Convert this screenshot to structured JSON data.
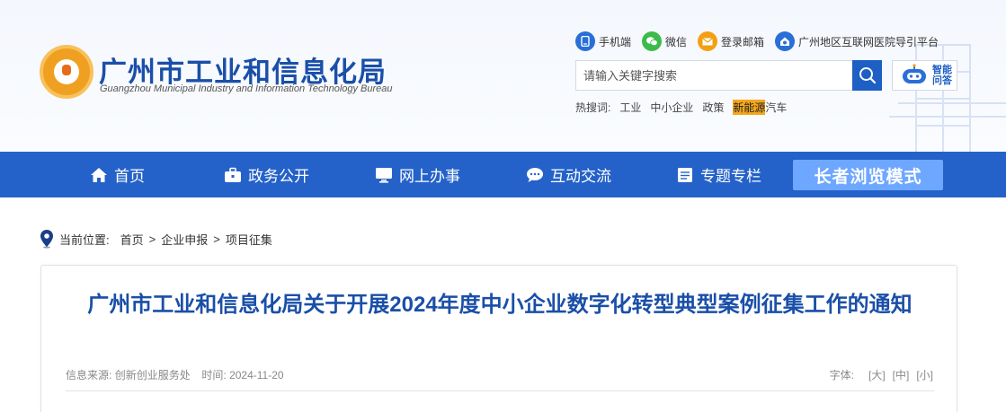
{
  "site": {
    "name_cn": "广州市工业和信息化局",
    "name_en": "Guangzhou Municipal Industry and Information Technology Bureau"
  },
  "toplinks": [
    {
      "label": "手机端",
      "icon": "mobile-icon",
      "color": "#2a6fd6"
    },
    {
      "label": "微信",
      "icon": "wechat-icon",
      "color": "#3dbb4a"
    },
    {
      "label": "登录邮箱",
      "icon": "mail-icon",
      "color": "#f2a012"
    },
    {
      "label": "广州地区互联网医院导引平台",
      "icon": "hospital-icon",
      "color": "#2a6fd6"
    }
  ],
  "search": {
    "placeholder": "请输入关键字搜索",
    "value": ""
  },
  "ai_assistant": {
    "label_line1": "智能",
    "label_line2": "问答"
  },
  "hot": {
    "label": "热搜词:",
    "items": [
      "工业",
      "中小企业",
      "政策",
      "新能源",
      "汽车"
    ]
  },
  "nav": {
    "items": [
      {
        "label": "首页",
        "icon": "home-icon"
      },
      {
        "label": "政务公开",
        "icon": "briefcase-icon"
      },
      {
        "label": "网上办事",
        "icon": "monitor-icon"
      },
      {
        "label": "互动交流",
        "icon": "chat-icon"
      },
      {
        "label": "专题专栏",
        "icon": "folder-icon"
      }
    ],
    "elder_mode": "长者浏览模式"
  },
  "breadcrumb": {
    "label": "当前位置:",
    "items": [
      "首页",
      "企业申报",
      "项目征集"
    ],
    "separator": ">"
  },
  "article": {
    "title": "广州市工业和信息化局关于开展2024年度中小企业数字化转型典型案例征集工作的通知",
    "source_label": "信息来源:",
    "source": "创新创业服务处",
    "time_label": "时间:",
    "time": "2024-11-20",
    "font_label": "字体:",
    "font_options": [
      "[大]",
      "[中]",
      "[小]"
    ]
  },
  "colors": {
    "brand_blue": "#1a4fa8",
    "nav_blue": "#2462c9",
    "elder_button": "#6ea7ff",
    "highlight": "#f4a71d"
  }
}
